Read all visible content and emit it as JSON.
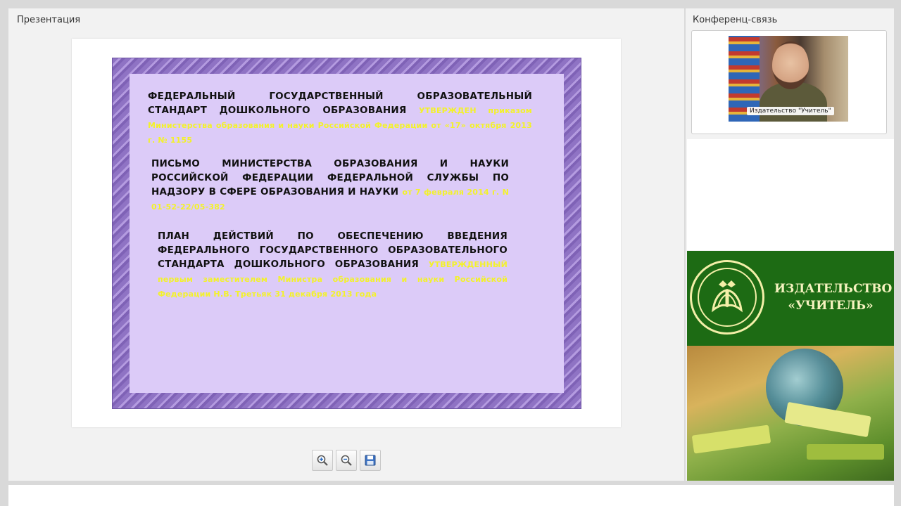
{
  "presentation": {
    "title": "Презентация",
    "slide": {
      "p1_text": "ФЕДЕРАЛЬНЫЙ ГОСУДАРСТВЕННЫЙ ОБРАЗОВАТЕЛЬНЫЙ СТАНДАРТ ДОШКОЛЬНОГО ОБРАЗОВАНИЯ ",
      "p1_highlight": "УТВЕРЖДЕН приказом Министерства образования и науки Российской Федерации от «17» октября 2013 г. № 1155",
      "p2_text": "ПИСЬМО МИНИСТЕРСТВА ОБРАЗОВАНИЯ И НАУКИ РОССИЙСКОЙ ФЕДЕРАЦИИ ФЕДЕРАЛЬНОЙ СЛУЖБЫ ПО НАДЗОРУ В СФЕРЕ ОБРАЗОВАНИЯ И НАУКИ ",
      "p2_highlight": "от 7 февраля 2014 г. N 01-52-22/05-382",
      "p3_text": "ПЛАН ДЕЙСТВИЙ ПО ОБЕСПЕЧЕНИЮ ВВЕДЕНИЯ ФЕДЕРАЛЬНОГО ГОСУДАРСТВЕННОГО ОБРАЗОВАТЕЛЬНОГО СТАНДАРТА ДОШКОЛЬНОГО ОБРАЗОВАНИЯ ",
      "p3_highlight": "УТВЕРЖДЕННЫЙ первым заместителем Министра образования и науки Российской Федерации Н.В. Третьяк 31 декабря 2013 года"
    },
    "toolbar": {
      "icons": [
        "zoom-in-icon",
        "zoom-out-icon",
        "save-icon"
      ]
    }
  },
  "conference": {
    "title": "Конференц-связь",
    "video_label": "Издательство \"Учитель\"",
    "banner": {
      "line1": "ИЗДАТЕЛЬСТВО",
      "line2": "«УЧИТЕЛЬ»"
    }
  },
  "colors": {
    "slide_border": "#8f73c4",
    "slide_fill": "#dccbf8",
    "highlight": "#f3f22a",
    "banner_green": "#1d6b14",
    "banner_text": "#f6f3c0"
  }
}
